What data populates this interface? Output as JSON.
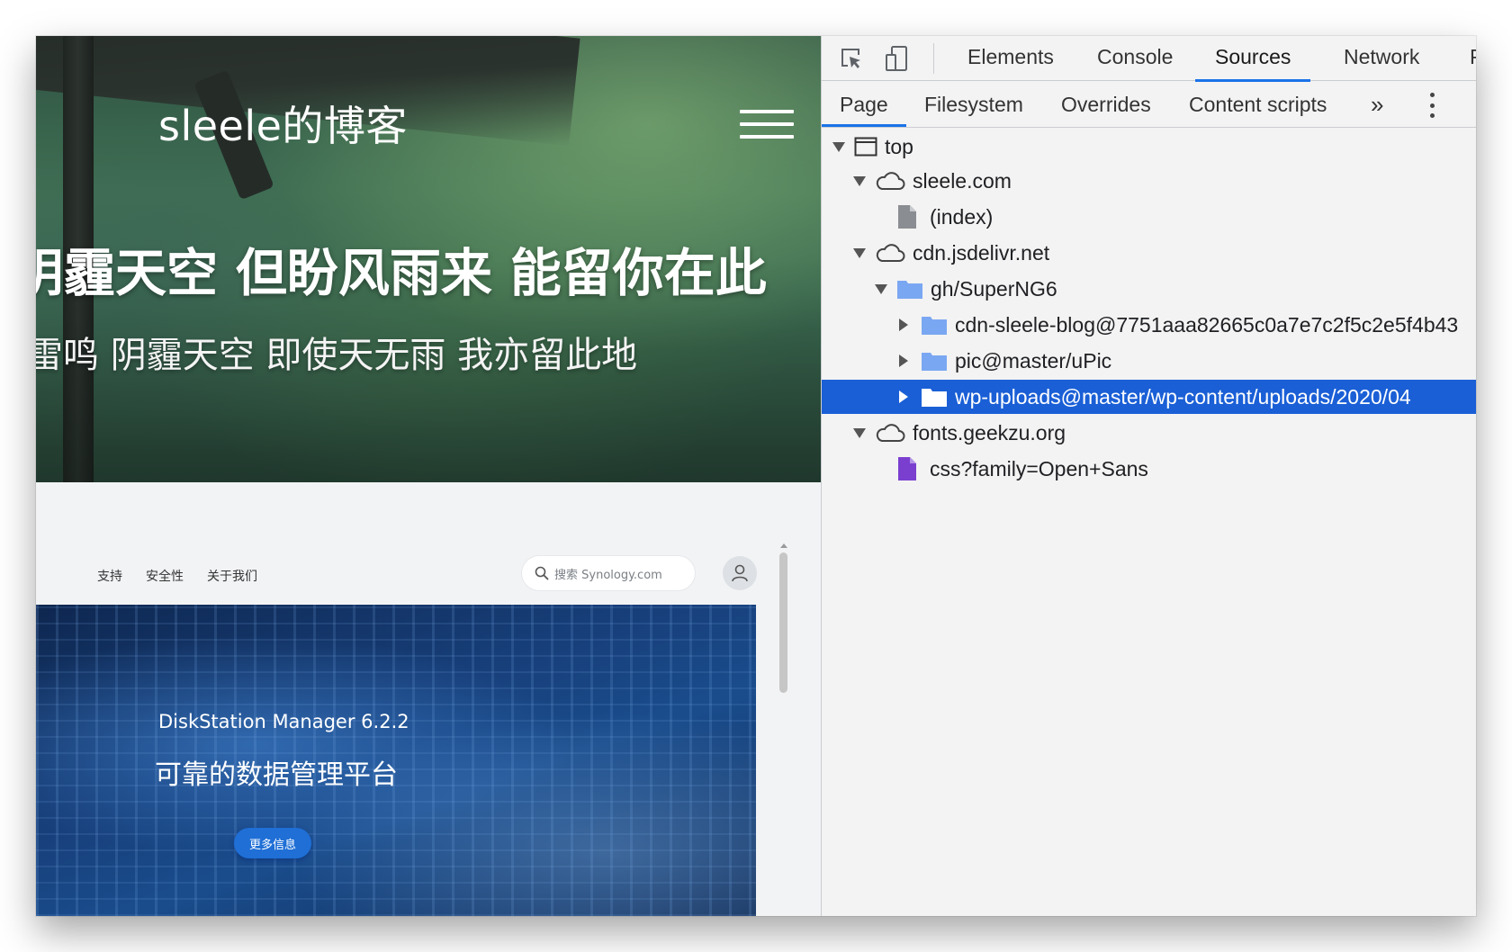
{
  "page": {
    "hero": {
      "site_title": "sleele的博客",
      "line1": "阴霾天空 但盼风雨来 能留你在此",
      "line2": "雷鸣 阴霾天空 即使天无雨 我亦留此地"
    },
    "synology": {
      "nav": [
        "支持",
        "安全性",
        "关于我们"
      ],
      "search_placeholder": "搜索 Synology.com",
      "banner_version": "DiskStation Manager 6.2.2",
      "banner_tagline": "可靠的数据管理平台",
      "more_button": "更多信息"
    }
  },
  "devtools": {
    "main_tabs": [
      "Elements",
      "Console",
      "Sources",
      "Network",
      "P"
    ],
    "active_main_tab": "Sources",
    "sub_tabs": [
      "Page",
      "Filesystem",
      "Overrides",
      "Content scripts"
    ],
    "active_sub_tab": "Page",
    "more_tabs_glyph": "»",
    "tree": [
      {
        "label": "top",
        "icon": "frame-icon",
        "expanded": true
      },
      {
        "label": "sleele.com",
        "icon": "cloud-icon",
        "expanded": true
      },
      {
        "label": "(index)",
        "icon": "file-icon"
      },
      {
        "label": "cdn.jsdelivr.net",
        "icon": "cloud-icon",
        "expanded": true
      },
      {
        "label": "gh/SuperNG6",
        "icon": "folder-icon",
        "expanded": true
      },
      {
        "label": "cdn-sleele-blog@7751aaa82665c0a7e7c2f5c2e5f4b43",
        "icon": "folder-icon",
        "expanded": false
      },
      {
        "label": "pic@master/uPic",
        "icon": "folder-icon",
        "expanded": false
      },
      {
        "label": "wp-uploads@master/wp-content/uploads/2020/04",
        "icon": "folder-icon",
        "expanded": false,
        "selected": true
      },
      {
        "label": "fonts.geekzu.org",
        "icon": "cloud-icon",
        "expanded": true
      },
      {
        "label": "css?family=Open+Sans",
        "icon": "stylesheet-icon"
      }
    ]
  },
  "colors": {
    "accent": "#1a73e8",
    "selection": "#1a5fd6",
    "folder": "#7aa7f2",
    "stylesheet_file": "#7b3fd0"
  }
}
